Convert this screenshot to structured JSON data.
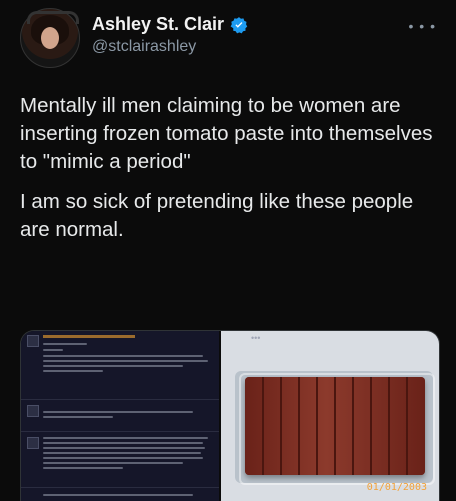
{
  "author": {
    "name": "Ashley St. Clair",
    "handle": "@stclairashley"
  },
  "tweet": {
    "paragraph1": "Mentally ill men claiming to be women are inserting frozen tomato paste into themselves to \"mimic a period\"",
    "paragraph2": "I am so sick of pretending like these people are normal."
  },
  "media": {
    "photo_timestamp": "01/01/2003",
    "right_dots": "•••"
  },
  "colors": {
    "background": "#0b0b0b",
    "text": "#e7e9ea",
    "muted": "#8b98a5",
    "verified": "#1d9bf0",
    "timestamp": "#f2a23a"
  },
  "icons": {
    "verified": "verified-badge-icon",
    "more": "more-options-icon"
  }
}
